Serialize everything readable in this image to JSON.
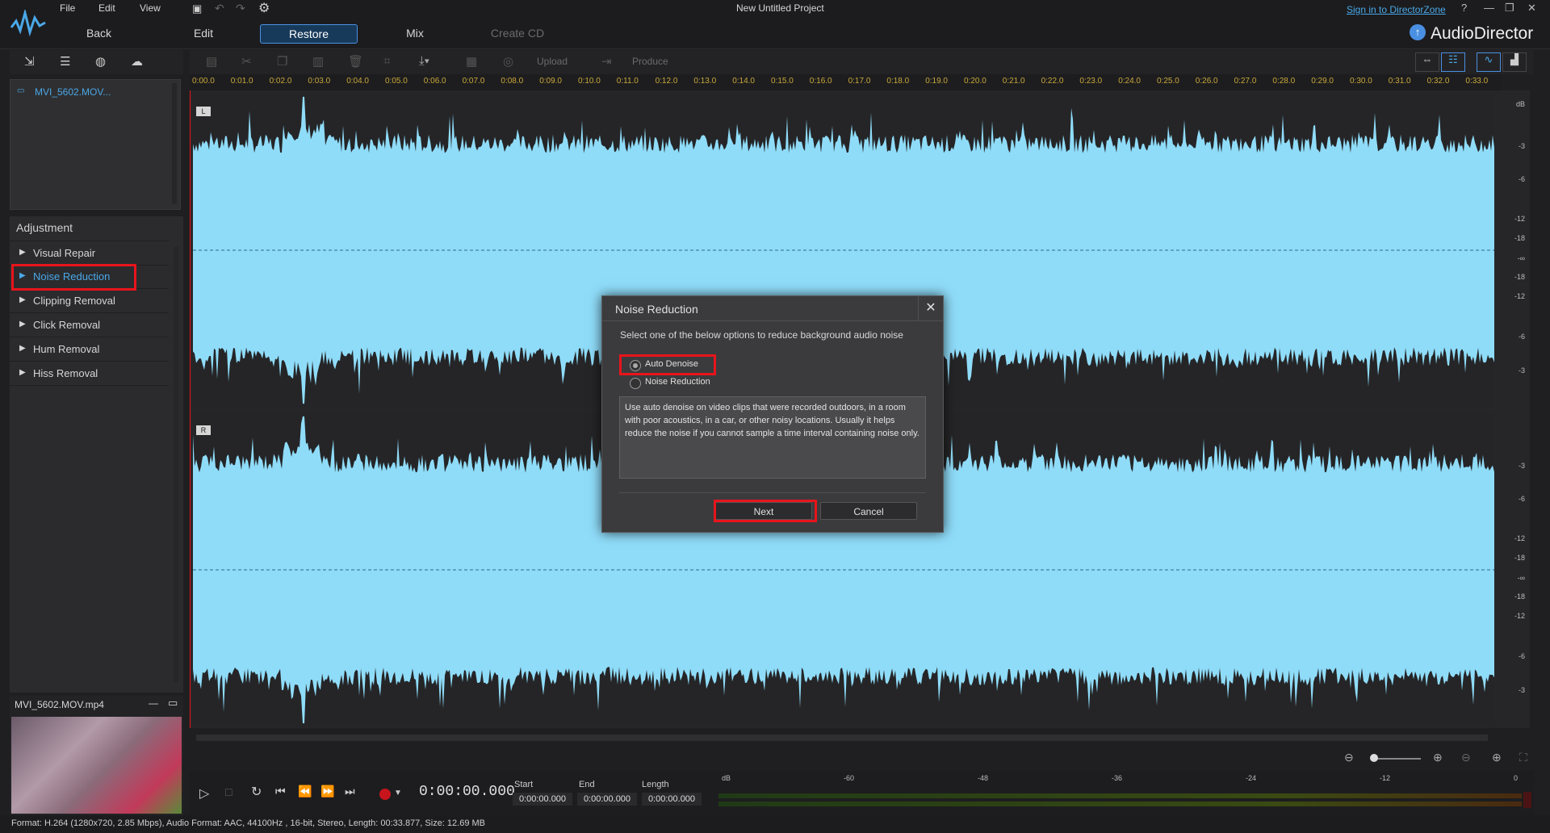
{
  "menu": {
    "file": "File",
    "edit": "Edit",
    "view": "View"
  },
  "window": {
    "project_title": "New Untitled Project",
    "sign_in": "Sign in to DirectorZone",
    "help": "?",
    "app_name": "AudioDirector"
  },
  "nav": {
    "back": "Back",
    "edit": "Edit",
    "restore": "Restore",
    "mix": "Mix",
    "create_cd": "Create CD"
  },
  "edit_toolbar": {
    "upload": "Upload",
    "produce": "Produce"
  },
  "library": {
    "items": [
      {
        "label": "MVI_5602.MOV..."
      }
    ]
  },
  "adjustment": {
    "header": "Adjustment",
    "items": [
      {
        "label": "Visual Repair"
      },
      {
        "label": "Noise Reduction"
      },
      {
        "label": "Clipping Removal"
      },
      {
        "label": "Click Removal"
      },
      {
        "label": "Hum Removal"
      },
      {
        "label": "Hiss Removal"
      }
    ]
  },
  "preview": {
    "file_name": "MVI_5602.MOV.mp4"
  },
  "ruler": {
    "ticks": [
      "0:00.0",
      "0:01.0",
      "0:02.0",
      "0:03.0",
      "0:04.0",
      "0:05.0",
      "0:06.0",
      "0:07.0",
      "0:08.0",
      "0:09.0",
      "0:10.0",
      "0:11.0",
      "0:12.0",
      "0:13.0",
      "0:14.0",
      "0:15.0",
      "0:16.0",
      "0:17.0",
      "0:18.0",
      "0:19.0",
      "0:20.0",
      "0:21.0",
      "0:22.0",
      "0:23.0",
      "0:24.0",
      "0:25.0",
      "0:26.0",
      "0:27.0",
      "0:28.0",
      "0:29.0",
      "0:30.0",
      "0:31.0",
      "0:32.0",
      "0:33.0"
    ]
  },
  "tracks": {
    "left_label": "L",
    "right_label": "R"
  },
  "db_scale": {
    "header": "dB",
    "left": [
      "-3",
      "-6",
      "-12",
      "-18",
      "-∞",
      "-18",
      "-12",
      "-6",
      "-3"
    ],
    "right": [
      "-3",
      "-6",
      "-12",
      "-18",
      "-∞",
      "-18",
      "-12",
      "-6",
      "-3"
    ]
  },
  "transport": {
    "timecode": "0:00:00.000",
    "start_label": "Start",
    "start_value": "0:00:00.000",
    "end_label": "End",
    "end_value": "0:00:00.000",
    "length_label": "Length",
    "length_value": "0:00:00.000"
  },
  "meter": {
    "labels": [
      "dB",
      "-60",
      "-48",
      "-36",
      "-24",
      "-12",
      "0"
    ]
  },
  "status": "Format: H.264 (1280x720, 2.85 Mbps), Audio Format: AAC, 44100Hz , 16-bit, Stereo, Length: 00:33.877, Size: 12.69 MB",
  "dialog": {
    "title": "Noise Reduction",
    "prompt": "Select one of the below options to reduce background audio noise",
    "options": [
      {
        "label": "Auto Denoise",
        "selected": true
      },
      {
        "label": "Noise Reduction",
        "selected": false
      }
    ],
    "description": "Use auto denoise on video clips that were recorded outdoors, in a room with poor acoustics, in a car, or other noisy locations. Usually it helps reduce the noise if you cannot sample a time interval containing noise only.",
    "next_label": "Next",
    "cancel_label": "Cancel"
  },
  "colors": {
    "waveform": "#8fdcf9",
    "accent": "#4a90e2",
    "highlight": "#e8141c",
    "ruler_text": "#c9a83a"
  }
}
